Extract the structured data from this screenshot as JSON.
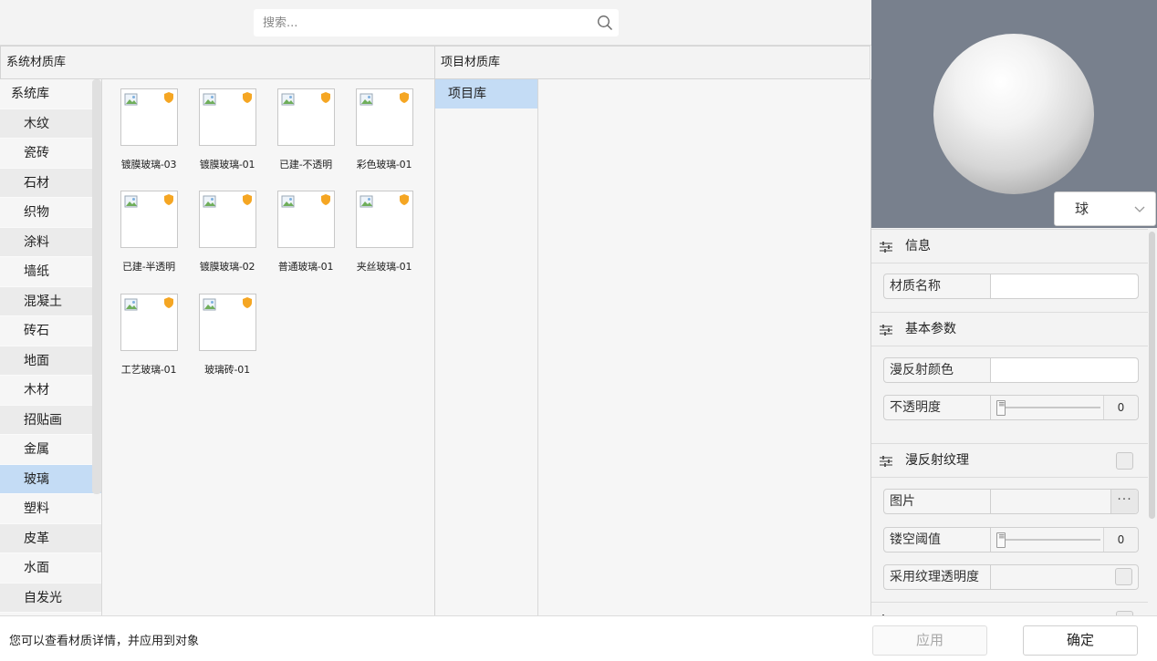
{
  "search": {
    "placeholder": "搜索..."
  },
  "system_library": {
    "header": "系统材质库",
    "categories": [
      {
        "label": "系统库",
        "selected": false
      },
      {
        "label": "木纹",
        "selected": false
      },
      {
        "label": "瓷砖",
        "selected": false
      },
      {
        "label": "石材",
        "selected": false
      },
      {
        "label": "织物",
        "selected": false
      },
      {
        "label": "涂料",
        "selected": false
      },
      {
        "label": "墙纸",
        "selected": false
      },
      {
        "label": "混凝土",
        "selected": false
      },
      {
        "label": "砖石",
        "selected": false
      },
      {
        "label": "地面",
        "selected": false
      },
      {
        "label": "木材",
        "selected": false
      },
      {
        "label": "招贴画",
        "selected": false
      },
      {
        "label": "金属",
        "selected": false
      },
      {
        "label": "玻璃",
        "selected": true
      },
      {
        "label": "塑料",
        "selected": false
      },
      {
        "label": "皮革",
        "selected": false
      },
      {
        "label": "水面",
        "selected": false
      },
      {
        "label": "自发光",
        "selected": false
      }
    ],
    "materials": [
      {
        "label": "镀膜玻璃-03",
        "icon": "image-placeholder-icon"
      },
      {
        "label": "镀膜玻璃-01",
        "icon": "image-placeholder-icon"
      },
      {
        "label": "已建-不透明",
        "icon": "image-placeholder-icon"
      },
      {
        "label": "彩色玻璃-01",
        "icon": "image-placeholder-icon"
      },
      {
        "label": "已建-半透明",
        "icon": "image-placeholder-icon"
      },
      {
        "label": "镀膜玻璃-02",
        "icon": "image-placeholder-icon"
      },
      {
        "label": "普通玻璃-01",
        "icon": "image-placeholder-icon"
      },
      {
        "label": "夹丝玻璃-01",
        "icon": "image-placeholder-icon"
      },
      {
        "label": "工艺玻璃-01",
        "icon": "image-placeholder-icon"
      },
      {
        "label": "玻璃砖-01",
        "icon": "image-placeholder-icon"
      }
    ]
  },
  "project_library": {
    "header": "项目材质库",
    "items": [
      {
        "label": "项目库",
        "selected": true
      }
    ]
  },
  "preview": {
    "shape": "球",
    "background_color": "#78808d"
  },
  "properties": {
    "info": {
      "title": "信息",
      "name_label": "材质名称",
      "name_value": ""
    },
    "basic": {
      "title": "基本参数",
      "diffuse_color_label": "漫反射颜色",
      "opacity_label": "不透明度",
      "opacity_value": "0"
    },
    "diffuse_texture": {
      "title": "漫反射纹理",
      "enabled": false,
      "image_label": "图片",
      "more_label": "···",
      "cutout_label": "镂空阈值",
      "cutout_value": "0",
      "use_alpha_label": "采用纹理透明度",
      "use_alpha": false
    }
  },
  "footer": {
    "status": "您可以查看材质详情，并应用到对象",
    "apply_label": "应用",
    "ok_label": "确定"
  },
  "colors": {
    "selection": "#c4dcf5",
    "panel_bg": "#f6f6f6",
    "badge": "#f5a623"
  }
}
